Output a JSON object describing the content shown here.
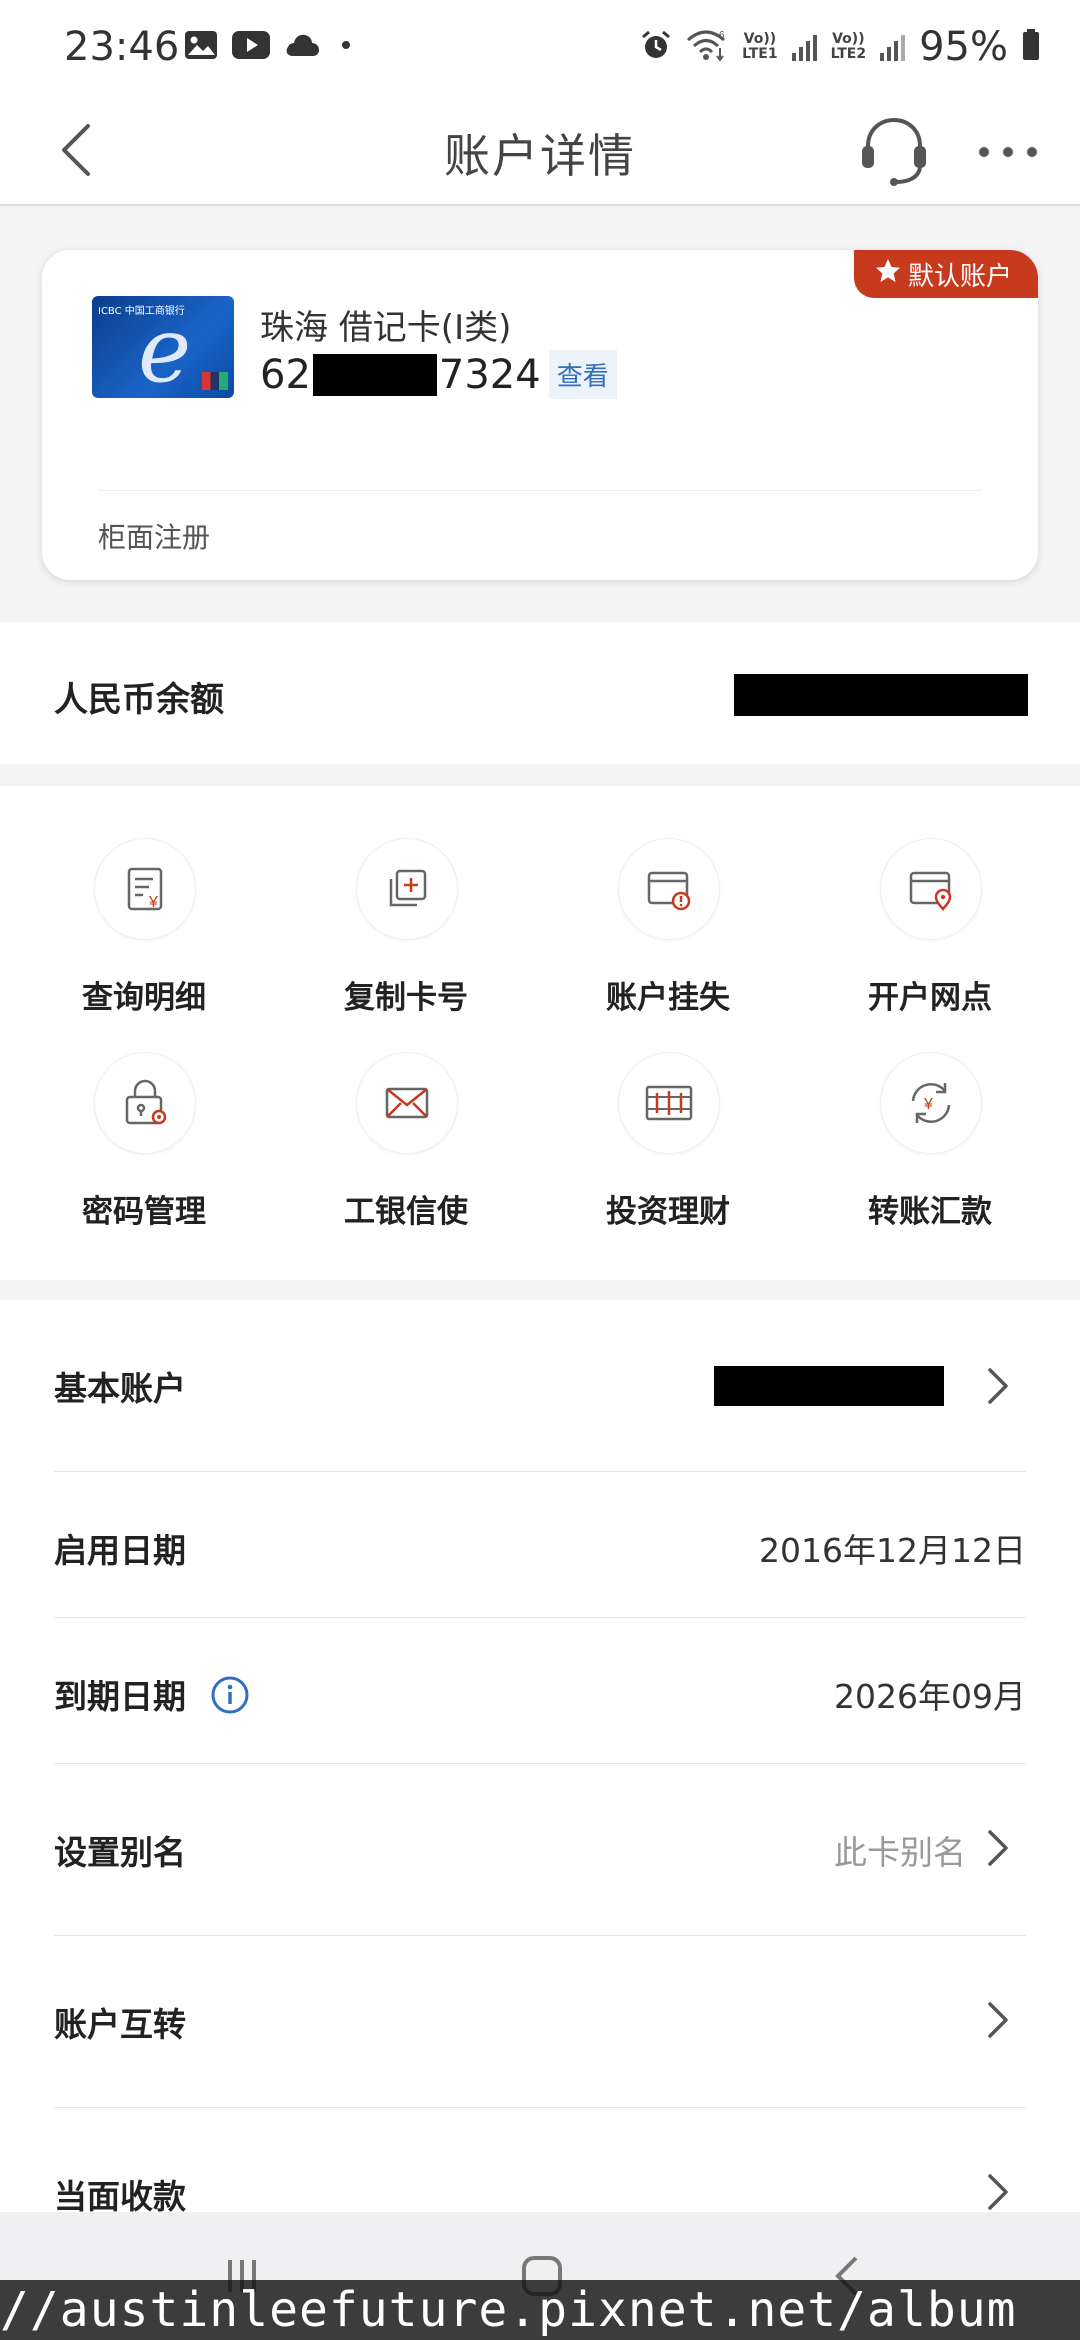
{
  "status_bar": {
    "time": "23:46",
    "battery": "95%",
    "sim1": [
      "Vo))",
      "LTE1"
    ],
    "sim2": [
      "Vo))",
      "LTE2"
    ],
    "icons": [
      "gallery-icon",
      "youtube-icon",
      "cloud-icon",
      "dot-icon",
      "alarm-icon",
      "wifi-icon",
      "signal-icon",
      "battery-icon"
    ]
  },
  "header": {
    "title": "账户详情",
    "icons": [
      "back-icon",
      "customer-service-icon",
      "more-icon"
    ]
  },
  "card": {
    "badge": "默认账户",
    "name": "珠海 借记卡(I类)",
    "number_prefix": "62",
    "number_suffix": "7324",
    "view_label": "查看",
    "registration": "柜面注册",
    "brand_text": "ICBC 中国工商银行"
  },
  "balance": {
    "label": "人民币余额"
  },
  "actions": [
    {
      "label": "查询明细",
      "icon": "statement-icon"
    },
    {
      "label": "复制卡号",
      "icon": "copy-icon"
    },
    {
      "label": "账户挂失",
      "icon": "report-loss-icon"
    },
    {
      "label": "开户网点",
      "icon": "branch-location-icon"
    },
    {
      "label": "密码管理",
      "icon": "password-icon"
    },
    {
      "label": "工银信使",
      "icon": "mail-icon"
    },
    {
      "label": "投资理财",
      "icon": "invest-icon"
    },
    {
      "label": "转账汇款",
      "icon": "transfer-icon"
    }
  ],
  "details": [
    {
      "label": "基本账户",
      "value": "",
      "masked": true,
      "chevron": true
    },
    {
      "label": "启用日期",
      "value": "2016年12月12日",
      "chevron": false
    },
    {
      "label": "到期日期",
      "value": "2026年09月",
      "info": true,
      "chevron": false
    },
    {
      "label": "设置别名",
      "value": "此卡别名",
      "placeholder": true,
      "chevron": true
    },
    {
      "label": "账户互转",
      "value": "",
      "chevron": true
    },
    {
      "label": "当面收款",
      "value": "",
      "chevron": true
    }
  ],
  "watermark": "//austinleefuture.pixnet.net/album",
  "colors": {
    "accent": "#c83a1e",
    "link": "#2f6fbd",
    "background": "#f4f4f5"
  }
}
